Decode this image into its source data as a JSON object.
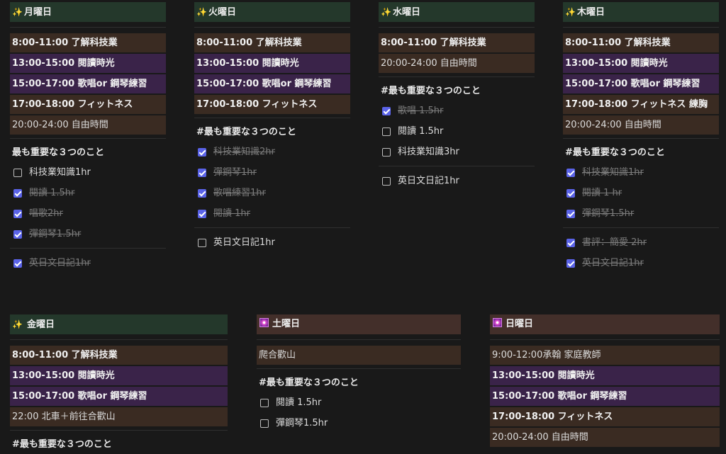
{
  "days": [
    {
      "header": "月曜日",
      "schedule": [
        "8:00-11:00 了解科技業",
        "13:00-15:00 閱讀時光",
        "15:00-17:00 歌唱or 鋼琴練習",
        "17:00-18:00 フィットネス",
        "20:00-24:00 自由時間"
      ],
      "task_title": "最も重要な３つのこと",
      "tasks": [
        {
          "label": "科技業知識1hr",
          "done": false
        },
        {
          "label": "閱讀 1.5hr",
          "done": true
        },
        {
          "label": "唱歌2hr",
          "done": true
        },
        {
          "label": "彈鋼琴1.5hr",
          "done": true
        }
      ],
      "extra": [
        {
          "label": "英日文日記1hr",
          "done": true
        }
      ]
    },
    {
      "header": "火曜日",
      "schedule": [
        "8:00-11:00 了解科技業",
        "13:00-15:00 閱讀時光",
        "15:00-17:00 歌唱or 鋼琴練習",
        "17:00-18:00 フィットネス"
      ],
      "task_title": "#最も重要な３つのこと",
      "tasks": [
        {
          "label": "科技業知識2hr",
          "done": true
        },
        {
          "label": "彈鋼琴1hr",
          "done": true
        },
        {
          "label": "歌唱練習1hr",
          "done": true
        },
        {
          "label": "閱讀 1hr",
          "done": true
        }
      ],
      "extra": [
        {
          "label": "英日文日記1hr",
          "done": false
        }
      ]
    },
    {
      "header": "水曜日",
      "schedule": [
        "8:00-11:00 了解科技業",
        "20:00-24:00 自由時間"
      ],
      "task_title": "#最も重要な３つのこと",
      "tasks": [
        {
          "label": "歌唱 1.5hr",
          "done": true
        },
        {
          "label": "閱讀 1.5hr",
          "done": false
        },
        {
          "label": "科技業知識3hr",
          "done": false
        }
      ],
      "extra": [
        {
          "label": "英日文日記1hr",
          "done": false
        }
      ]
    },
    {
      "header": "木曜日",
      "schedule": [
        "8:00-11:00 了解科技業",
        "13:00-15:00 閱讀時光",
        "15:00-17:00 歌唱or 鋼琴練習",
        "17:00-18:00 フィットネス 練胸",
        "20:00-24:00 自由時間"
      ],
      "task_title": "#最も重要な３つのこと",
      "tasks": [
        {
          "label": "科技業知識1hr",
          "done": true
        },
        {
          "label": "閱讀 1 hr",
          "done": true
        },
        {
          "label": "彈鋼琴1.5hr",
          "done": true
        }
      ],
      "extra": [
        {
          "label": "書評：簡愛 2hr",
          "done": true
        },
        {
          "label": "英日文日記1hr",
          "done": true
        }
      ]
    },
    {
      "header": "金曜日",
      "schedule": [
        "8:00-11:00 了解科技業",
        "13:00-15:00 閱讀時光",
        "15:00-17:00 歌唱or 鋼琴練習",
        "22:00 北車＋前往合歡山"
      ],
      "task_title": "#最も重要な３つのこと",
      "tasks": [],
      "extra": []
    },
    {
      "header": "土曜日",
      "schedule": [
        "爬合歡山"
      ],
      "task_title": "#最も重要な３つのこと",
      "tasks": [
        {
          "label": "閱讀 1.5hr",
          "done": false
        },
        {
          "label": "彈鋼琴1.5hr",
          "done": false
        }
      ],
      "extra": []
    },
    {
      "header": "日曜日",
      "schedule": [
        "9:00-12:00承翰 家庭教師",
        "13:00-15:00 閱讀時光",
        "15:00-17:00 歌唱or 鋼琴練習",
        "17:00-18:00 フィットネス",
        "20:00-24:00 自由時間"
      ],
      "task_title": "",
      "tasks": [],
      "extra": []
    }
  ],
  "colors": {
    "background": "#191919",
    "header_green": "#24382b",
    "header_brown": "#432f2a",
    "block_brown": "#3a2b22",
    "block_purple": "#3a2349",
    "checkbox_checked": "#5a63e8",
    "sparkle": "#f7d54a"
  },
  "icons": {
    "weekday": "sparkles-icon",
    "weekend": "star-square-icon"
  }
}
